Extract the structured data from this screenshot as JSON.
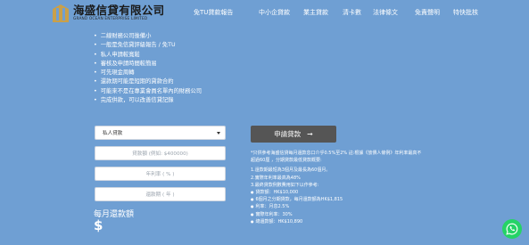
{
  "brand": {
    "title": "海盛信貸有限公司",
    "subtitle": "GRAND OCEAN ENTERPRISE LIMITED"
  },
  "nav": [
    "免TU貸款報告",
    "中小企貸款",
    "業主貸款",
    "清卡數",
    "法律條文",
    "免責聲明",
    "特快批核"
  ],
  "bullets": [
    "二線財務公司後備小",
    "一般是免信貸評級報告 / 免TU",
    "私人申請較寬鬆",
    "審核及申請時間較簡易",
    "可先現金周轉",
    "還款期可能是短期的貸款合約",
    "可能來不是在專業會員名單內的財務公司",
    "完成供款，可以改善信貸記錄"
  ],
  "form": {
    "loan_type": "私人貸款",
    "amount_placeholder": "貸款額 (例如: $400000)",
    "rate_placeholder": "年利率 ( % )",
    "term_placeholder": "還款期 ( 年 )",
    "monthly_label": "每月還款額",
    "monthly_value": "$"
  },
  "apply_button": {
    "label": "申請貸款",
    "icon": "arrow-right-icon"
  },
  "info": {
    "l1": "*只供參考海盛信貸每月還款息口介乎0.5%至2% 註:根據《放債人條例》年利率最高不",
    "l2": "超過60厘 ，分期貸款最低貸款概要:",
    "l3": "1.還款期最短為3個月及最長為60個月。",
    "l4": "2.實際年利率最高為48%",
    "l5": "3.最終貸款例數費用如下以作參考:",
    "l6": "貸款額：HK$10,000",
    "l7": "6個月之分期貸款，每月還款額為HK$1,815",
    "l8": "利率：月息2.5%",
    "l9": "實際年利率：30%",
    "l10": "總還款額：HK$10,890"
  },
  "colors": {
    "background": "#6f9fd3",
    "button": "#555555",
    "whatsapp": "#25d366",
    "logo_gold": "#c9a04a"
  },
  "icons": {
    "whatsapp": "whatsapp-icon",
    "select_caret": "caret-down-icon"
  }
}
